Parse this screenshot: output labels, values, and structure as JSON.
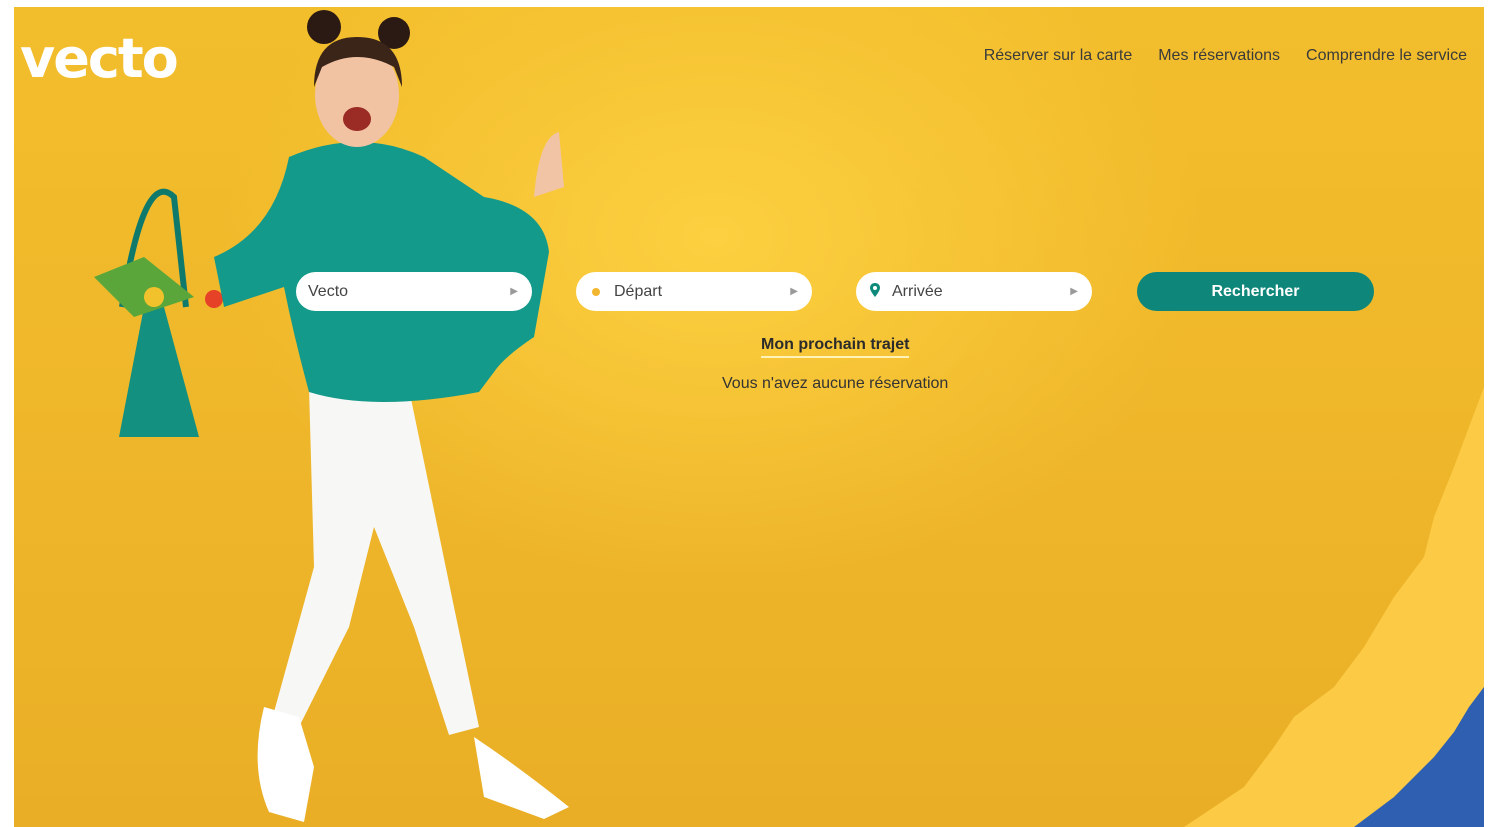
{
  "brand": {
    "logo": "vecto"
  },
  "nav": {
    "items": [
      "Réserver sur la carte",
      "Mes réservations",
      "Comprendre le service"
    ]
  },
  "search": {
    "vecto_label": "Vecto",
    "depart_label": "Départ",
    "arrivee_label": "Arrivée",
    "button_label": "Rechercher"
  },
  "trip": {
    "title": "Mon prochain trajet",
    "empty": "Vous n'avez aucune réservation"
  },
  "colors": {
    "background": "#f3be2c",
    "accent": "#0e877a",
    "blue": "#2f5fb0"
  },
  "icons": [
    "chevron-right-icon",
    "location-pin-icon",
    "dot-icon"
  ]
}
